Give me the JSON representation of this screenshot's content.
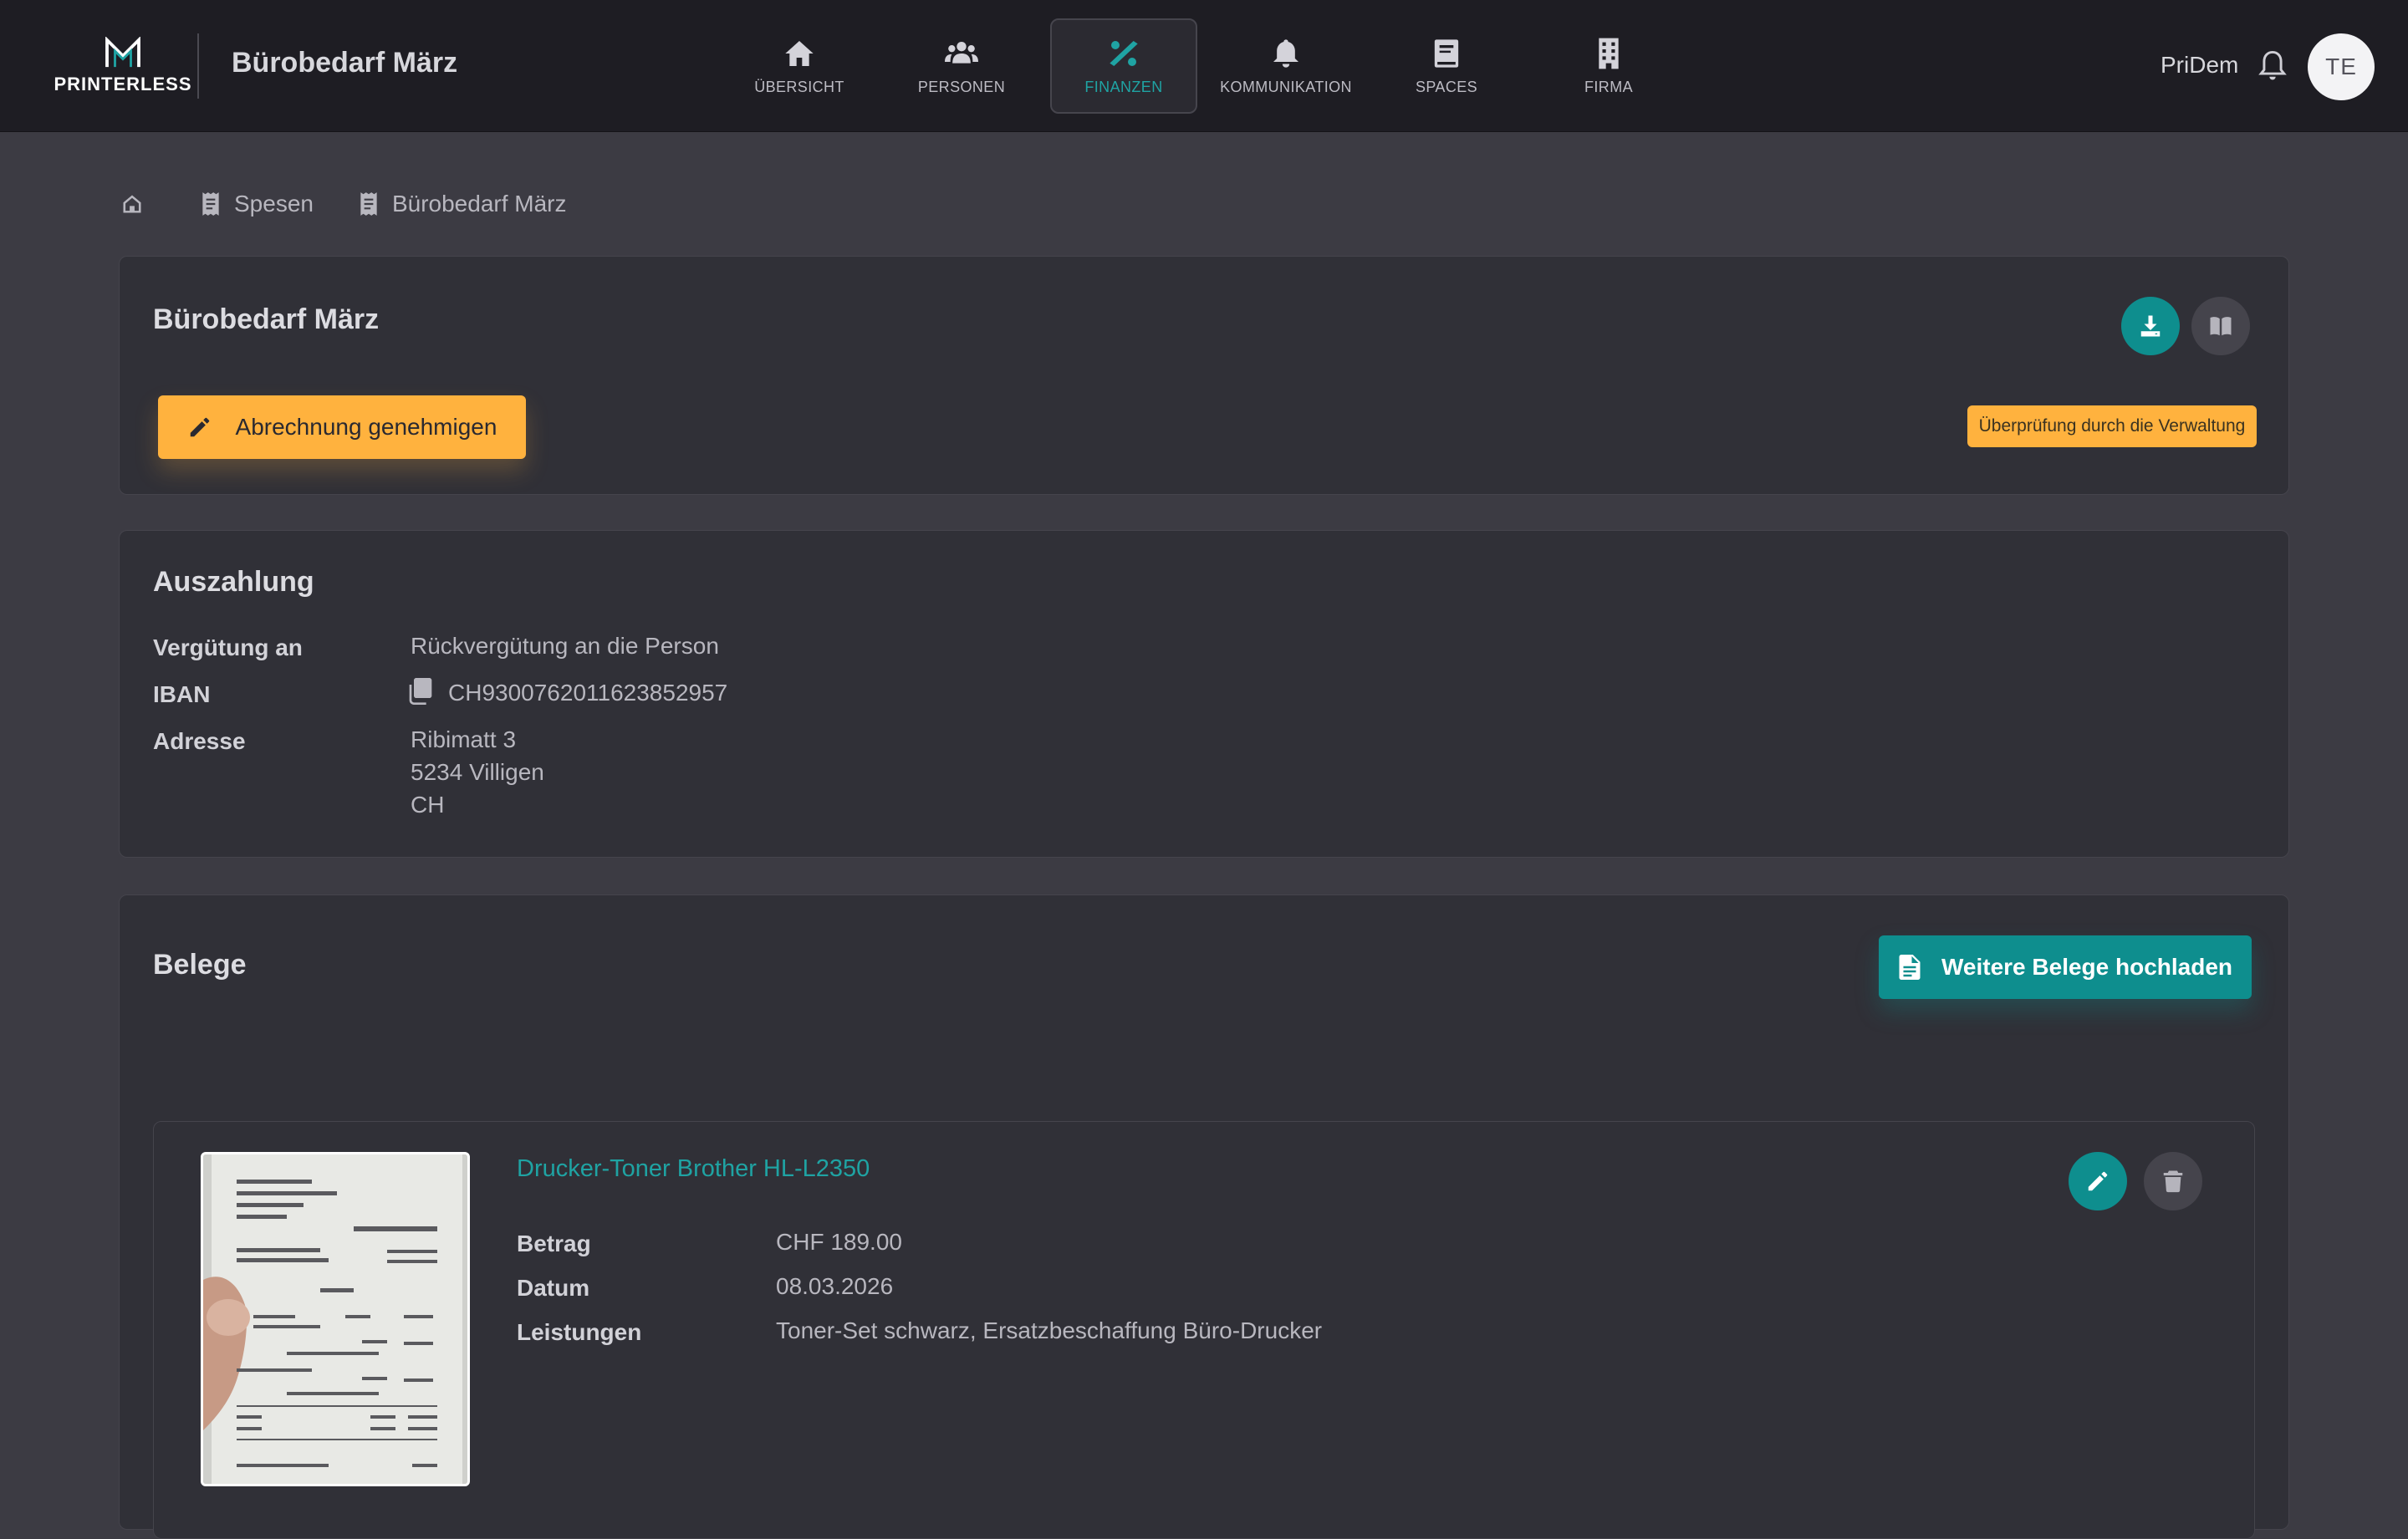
{
  "header": {
    "brand": "PRINTERLESS",
    "app_title": "Bürobedarf März",
    "nav": [
      {
        "label": "ÜBERSICHT",
        "icon": "home-icon"
      },
      {
        "label": "PERSONEN",
        "icon": "users-icon"
      },
      {
        "label": "FINANZEN",
        "icon": "percent-icon",
        "active": true
      },
      {
        "label": "KOMMUNIKATION",
        "icon": "bell-icon"
      },
      {
        "label": "SPACES",
        "icon": "book-icon"
      },
      {
        "label": "FIRMA",
        "icon": "building-icon"
      }
    ],
    "user_name": "PriDem",
    "avatar_initials": "TE"
  },
  "breadcrumb": {
    "items": [
      "Spesen",
      "Bürobedarf März"
    ]
  },
  "expense": {
    "title": "Bürobedarf März",
    "approve_label": "Abrechnung genehmigen",
    "status": "Überprüfung durch die Verwaltung"
  },
  "payout": {
    "title": "Auszahlung",
    "rows": {
      "compensation_label": "Vergütung an",
      "compensation_value": "Rückvergütung an die Person",
      "iban_label": "IBAN",
      "iban_value": "CH9300762011623852957",
      "address_label": "Adresse",
      "address_line1": "Ribimatt 3",
      "address_line2": "5234 Villigen",
      "address_line3": "CH"
    }
  },
  "receipts": {
    "title": "Belege",
    "upload_label": "Weitere Belege hochladen",
    "items": [
      {
        "name": "Drucker-Toner Brother HL-L2350",
        "amount_label": "Betrag",
        "amount": "CHF 189.00",
        "date_label": "Datum",
        "date": "08.03.2026",
        "services_label": "Leistungen",
        "services": "Toner-Set schwarz, Ersatzbeschaffung Büro-Drucker"
      }
    ]
  },
  "colors": {
    "accent": "#0e8e8e",
    "warning": "#ffb23e",
    "background": "#3c3b43",
    "topbar": "#1e1d23"
  }
}
